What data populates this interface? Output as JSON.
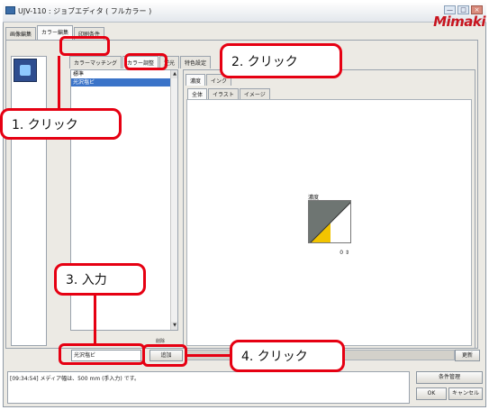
{
  "window": {
    "title": "UJV-110 : ジョブエディタ ( フルカラー )",
    "brand": "Mimaki",
    "controls": {
      "minimize": "—",
      "maximize": "□",
      "close": "×"
    }
  },
  "top_tabs": [
    "画像編集",
    "カラー編集",
    "印刷条件"
  ],
  "sub_tabs": [
    "カラーマッチング",
    "カラー調整",
    "逆光",
    "特色設定"
  ],
  "color_list": {
    "items": [
      "標準",
      "光沢塩ビ"
    ],
    "selected_index": 1,
    "scroll_up": "▲",
    "scroll_down": "▼"
  },
  "adjust_tabs": [
    "濃度",
    "インク"
  ],
  "adjust_subtabs": [
    "全体",
    "イラスト",
    "イメージ"
  ],
  "curve": {
    "label": "濃度",
    "value": "0"
  },
  "name_input": {
    "value": "光沢塩ビ"
  },
  "delete_label": "削除",
  "add_button": "追加",
  "update_button": "更新",
  "log_message": "[09:34:54] メディア幅は、500 mm (手入力) です。",
  "condition_button": "条件管理",
  "ok_button": "OK",
  "cancel_button": "キャンセル",
  "callouts": [
    "1.  クリック",
    "2.  クリック",
    "3.  入力",
    "4.  クリック"
  ],
  "colors": {
    "highlight": "#e60012",
    "selection": "#3b74c9",
    "brand": "#c8141e"
  }
}
